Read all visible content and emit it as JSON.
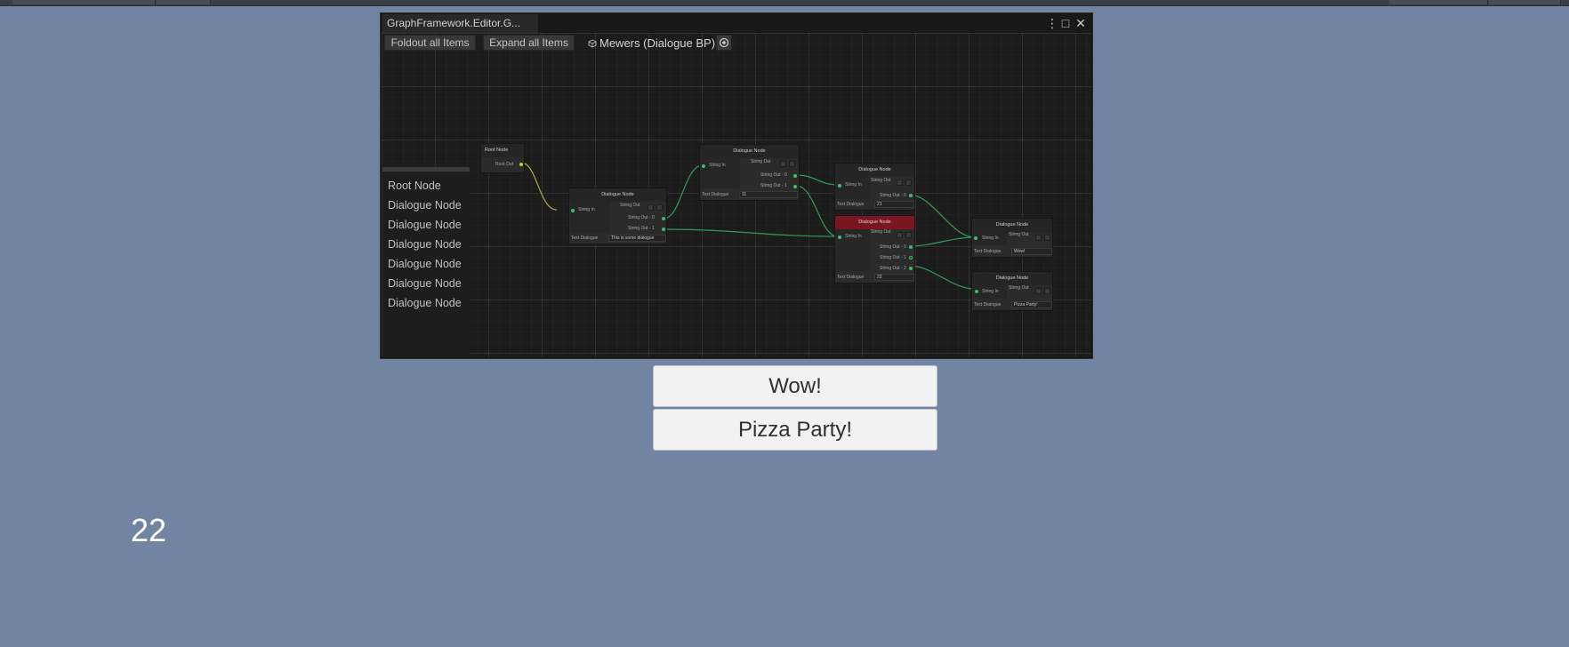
{
  "editor_window": {
    "tab_title": "GraphFramework.Editor.G...",
    "controls": {
      "menu": "⋮",
      "maximize": "□",
      "close": "✕"
    },
    "toolbar": {
      "foldout_label": "Foldout all Items",
      "expand_label": "Expand all Items",
      "asset_label": "Mewers (Dialogue BP)"
    },
    "sidebar_items": [
      "Root Node",
      "Dialogue Node",
      "Dialogue Node",
      "Dialogue Node",
      "Dialogue Node",
      "Dialogue Node",
      "Dialogue Node"
    ],
    "nodes": {
      "root": {
        "title": "Root Node",
        "out": "Root Out"
      },
      "n1": {
        "title": "Dialogue Node",
        "in": "String In",
        "out": "String Out",
        "out0": "String Out - 0",
        "out1": "String Out - 1",
        "text_label": "Text Dialogue",
        "text": "This is some dialogue"
      },
      "n2": {
        "title": "Dialogue Node",
        "in": "String In",
        "out": "String Out",
        "out0": "String Out - 0",
        "out1": "String Out - 1",
        "text_label": "Text Dialogue",
        "text": "11"
      },
      "n3": {
        "title": "Dialogue Node",
        "in": "String In",
        "out": "String Out",
        "out0": "String Out - 0",
        "text_label": "Text Dialogue",
        "text": "21"
      },
      "n4": {
        "title": "Dialogue Node",
        "in": "String In",
        "out": "String Out",
        "out0": "String Out - 0",
        "out1": "String Out - 1",
        "out2": "String Out - 2",
        "text_label": "Text Dialogue",
        "text": "22"
      },
      "n5": {
        "title": "Dialogue Node",
        "in": "String In",
        "out": "String Out",
        "text_label": "Text Dialogue",
        "text": "Wow!"
      },
      "n6": {
        "title": "Dialogue Node",
        "in": "String In",
        "out": "String Out",
        "text_label": "Text Dialogue",
        "text": "Pizza Party!"
      }
    },
    "colors": {
      "edge": "#2f9d5a",
      "root_edge": "#b4b23a",
      "selected_header": "#7a1622"
    }
  },
  "choices": [
    {
      "label": "Wow!"
    },
    {
      "label": "Pizza Party!"
    }
  ],
  "counter_text": "22",
  "colors": {
    "background": "#7184a2",
    "button_bg": "#f2f2f2"
  }
}
